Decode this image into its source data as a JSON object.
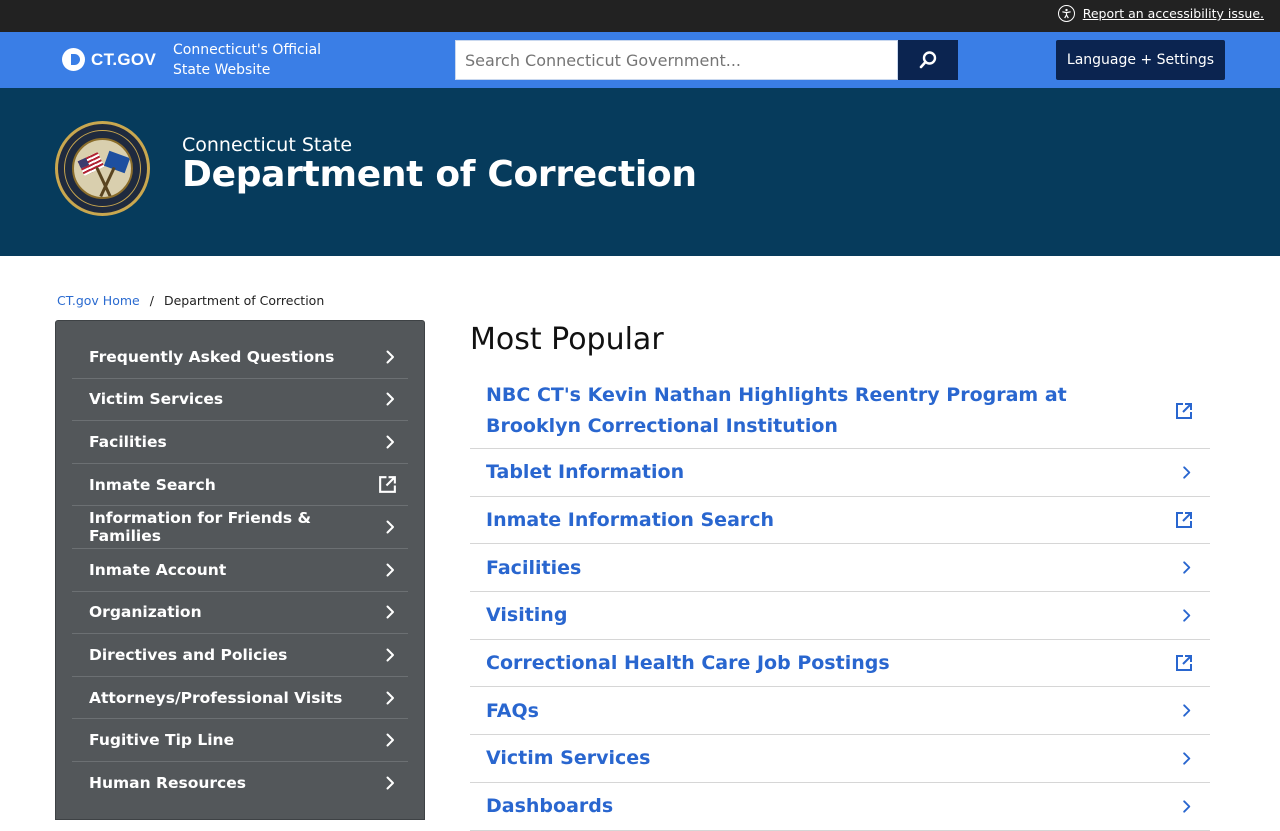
{
  "utility_bar": {
    "accessibility_link": "Report an accessibility issue."
  },
  "header": {
    "logo_text": "CT.GOV",
    "official_text": "Connecticut's Official State Website",
    "search_placeholder": "Search Connecticut Government...",
    "language_button": "Language + Settings"
  },
  "banner": {
    "pre_title": "Connecticut State",
    "agency_title": "Department of Correction",
    "seal_text": "CONNECTICUT DEPARTMENT OF CORRECTION"
  },
  "breadcrumb": {
    "home": "CT.gov Home",
    "separator": "/",
    "current": "Department of Correction"
  },
  "sidebar": {
    "items": [
      {
        "label": "Frequently Asked Questions",
        "icon": "chevron-right"
      },
      {
        "label": "Victim Services",
        "icon": "chevron-right"
      },
      {
        "label": "Facilities",
        "icon": "chevron-right"
      },
      {
        "label": "Inmate Search",
        "icon": "external-link"
      },
      {
        "label": "Information for Friends & Families",
        "icon": "chevron-right"
      },
      {
        "label": "Inmate Account",
        "icon": "chevron-right"
      },
      {
        "label": "Organization",
        "icon": "chevron-right"
      },
      {
        "label": "Directives and Policies",
        "icon": "chevron-right"
      },
      {
        "label": "Attorneys/Professional Visits",
        "icon": "chevron-right"
      },
      {
        "label": "Fugitive Tip Line",
        "icon": "chevron-right"
      },
      {
        "label": "Human Resources",
        "icon": "chevron-right"
      }
    ]
  },
  "main": {
    "title": "Most Popular",
    "popular": [
      {
        "label": "NBC CT's Kevin Nathan Highlights Reentry Program at Brooklyn Correctional Institution",
        "icon": "external-link"
      },
      {
        "label": "Tablet Information",
        "icon": "chevron-right"
      },
      {
        "label": "Inmate Information Search",
        "icon": "external-link"
      },
      {
        "label": "Facilities",
        "icon": "chevron-right"
      },
      {
        "label": "Visiting",
        "icon": "chevron-right"
      },
      {
        "label": "Correctional Health Care Job Postings",
        "icon": "external-link"
      },
      {
        "label": "FAQs",
        "icon": "chevron-right"
      },
      {
        "label": "Victim Services",
        "icon": "chevron-right"
      },
      {
        "label": "Dashboards",
        "icon": "chevron-right"
      }
    ]
  },
  "colors": {
    "utility_bar": "#222222",
    "header_blue": "#3a7ee6",
    "navy_button": "#0b2450",
    "banner": "#063b5c",
    "sidebar": "#53575a",
    "link_blue": "#2966cf"
  }
}
